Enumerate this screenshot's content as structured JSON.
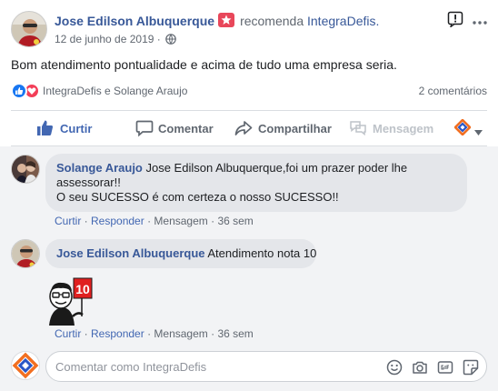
{
  "post": {
    "author": "Jose Edilson Albuquerque",
    "verb": "recomenda",
    "page": "IntegraDefis.",
    "date": "12 de junho de 2019",
    "date_sep": " · ",
    "text": "Bom atendimento pontualidade e acima de tudo uma empresa seria.",
    "icons": {
      "badge": "recommendation-badge-icon",
      "audience": "globe-icon",
      "report": "flag-icon",
      "more": "more-options-icon"
    }
  },
  "reactions": {
    "names": "IntegraDefis e Solange Araujo",
    "comment_count": "2 comentários",
    "icons": [
      "like-reaction-icon",
      "love-reaction-icon"
    ]
  },
  "actions": {
    "like": "Curtir",
    "comment": "Comentar",
    "share": "Compartilhar",
    "message": "Mensagem"
  },
  "comments": [
    {
      "author": "Solange Araujo",
      "line1": " Jose Edilson Albuquerque,foi um prazer poder lhe",
      "line2": "assessorar!!",
      "line3": "O seu SUCESSO é com certeza o nosso SUCESSO!!",
      "like": "Curtir",
      "reply": "Responder",
      "message": "Mensagem",
      "time": "36 sem",
      "sep": " · "
    },
    {
      "author": "Jose Edilson Albuquerque",
      "text": " Atendimento nota 10",
      "sticker_text": "10",
      "like": "Curtir",
      "reply": "Responder",
      "message": "Mensagem",
      "time": "36 sem",
      "sep": " · "
    }
  ],
  "composer": {
    "placeholder": "Comentar como IntegraDefis",
    "icons": [
      "emoji-icon",
      "camera-icon",
      "gif-icon",
      "sticker-icon"
    ]
  },
  "colors": {
    "link": "#385898",
    "like_blue": "#4267b2",
    "love_red": "#f33e58",
    "brand_orange": "#f26f21",
    "brand_blue": "#2a56c6"
  }
}
